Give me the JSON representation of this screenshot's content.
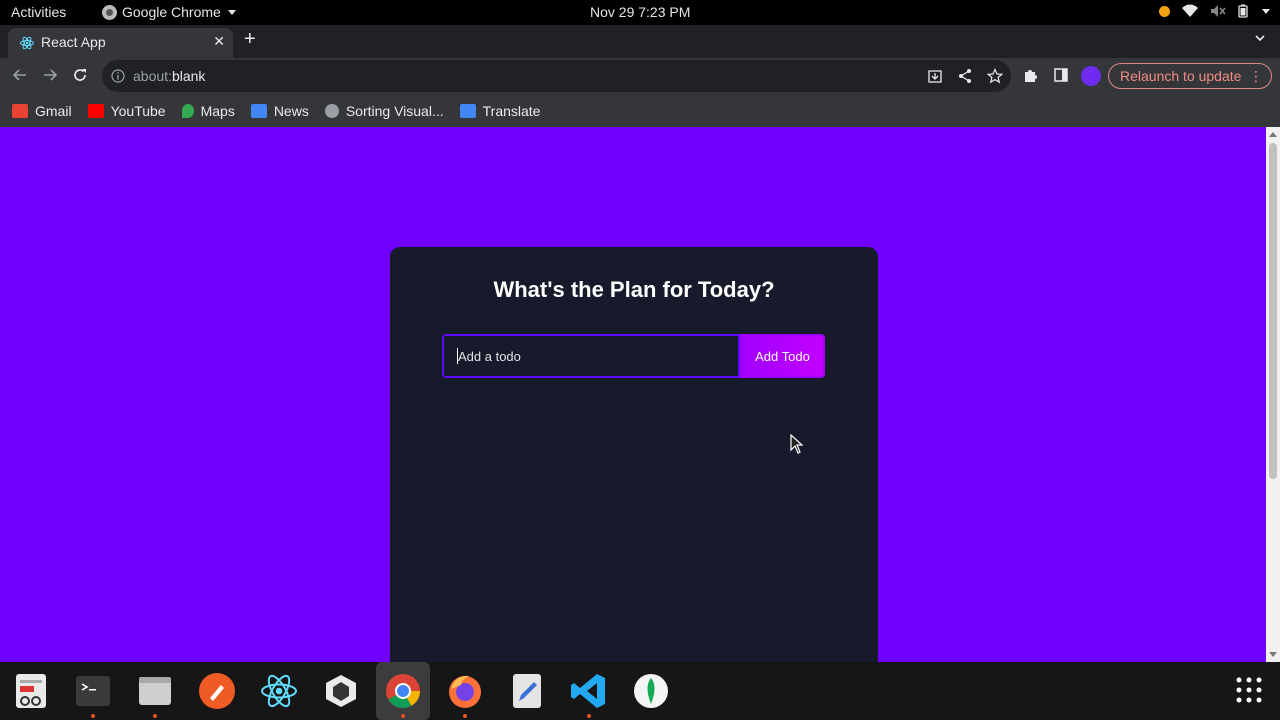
{
  "topbar": {
    "activities": "Activities",
    "app_name": "Google Chrome",
    "datetime": "Nov 29  7:23 PM"
  },
  "browser": {
    "tab_title": "React App",
    "url_prefix": "about:",
    "url_rest": "blank",
    "relaunch_label": "Relaunch to update",
    "bookmarks": [
      {
        "label": "Gmail",
        "icon": "gmail-icon",
        "color": "#ea4335"
      },
      {
        "label": "YouTube",
        "icon": "youtube-icon",
        "color": "#ff0000"
      },
      {
        "label": "Maps",
        "icon": "maps-icon",
        "color": "#34a853"
      },
      {
        "label": "News",
        "icon": "news-icon",
        "color": "#4285f4"
      },
      {
        "label": "Sorting Visual...",
        "icon": "globe-icon",
        "color": "#9aa0a6"
      },
      {
        "label": "Translate",
        "icon": "translate-icon",
        "color": "#4285f4"
      }
    ]
  },
  "app": {
    "heading": "What's the Plan for Today?",
    "input_placeholder": "Add a todo",
    "button_label": "Add Todo",
    "colors": {
      "page_bg": "#7000ff",
      "card_bg": "#161a2b",
      "input_border": "#5d0cff",
      "button_bg": "#a000ff"
    }
  },
  "dock": {
    "apps": [
      "text-editor-icon",
      "terminal-icon",
      "files-icon",
      "postman-icon",
      "react-icon",
      "unity-icon",
      "chrome-icon",
      "firefox-icon",
      "gedit-icon",
      "vscode-icon",
      "mongodb-icon"
    ],
    "running": [
      "terminal-icon",
      "files-icon",
      "chrome-icon",
      "firefox-icon",
      "vscode-icon"
    ],
    "active": "chrome-icon"
  }
}
